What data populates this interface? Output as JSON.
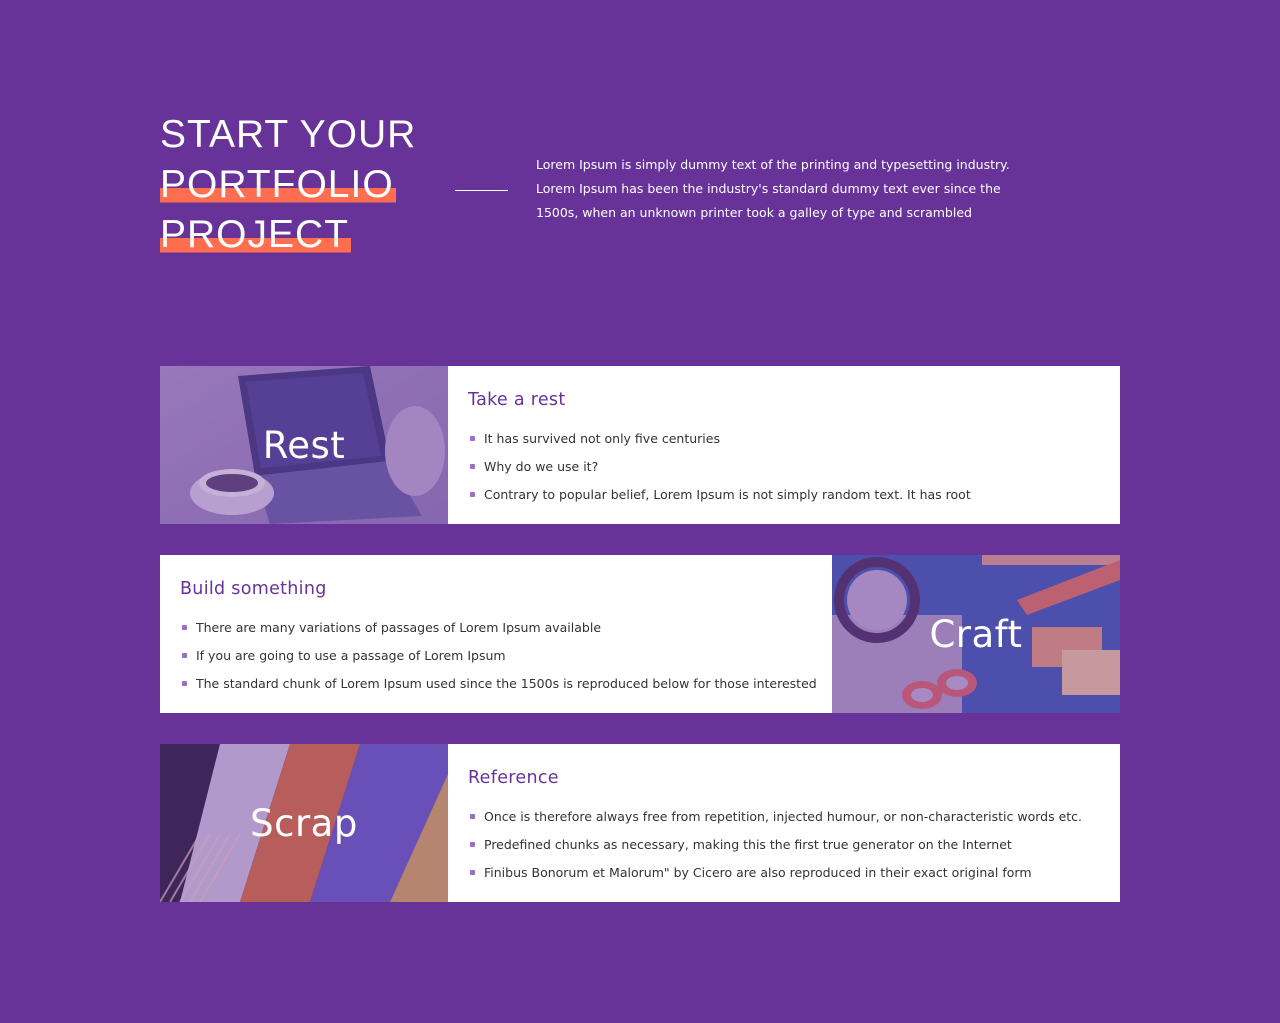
{
  "hero": {
    "title_line1": "START YOUR",
    "title_line2": "PORTFOLIO",
    "title_line3": "PROJECT",
    "description": "Lorem Ipsum is simply dummy text of the printing and typesetting industry. Lorem Ipsum has been the industry's standard dummy text ever since the 1500s, when an unknown printer took a galley of type and scrambled"
  },
  "colors": {
    "background": "#673399",
    "highlight": "#ff6f4f",
    "heading": "#673399",
    "bullet": "#9b6ec9",
    "card": "#ffffff"
  },
  "cards": [
    {
      "image_label": "Rest",
      "image_icon": "laptop-coffee-photo",
      "heading": "Take a rest",
      "items": [
        "It has survived not only five centuries",
        "Why do we use it?",
        "Contrary to popular belief, Lorem Ipsum is not simply random text. It has root"
      ]
    },
    {
      "image_label": "Craft",
      "image_icon": "craft-tools-photo",
      "heading": "Build something",
      "items": [
        "There are many variations of passages of Lorem Ipsum available",
        "If you are going to use a passage of Lorem Ipsum",
        "The standard chunk of Lorem Ipsum used since the 1500s is reproduced below for those interested"
      ]
    },
    {
      "image_label": "Scrap",
      "image_icon": "scrapbook-collage-photo",
      "heading": "Reference",
      "items": [
        "Once is therefore always free from repetition, injected humour, or non-characteristic words etc.",
        "Predefined chunks as necessary, making this the first true generator on the Internet",
        "Finibus Bonorum et Malorum\" by Cicero are also reproduced in their exact original form"
      ]
    }
  ]
}
